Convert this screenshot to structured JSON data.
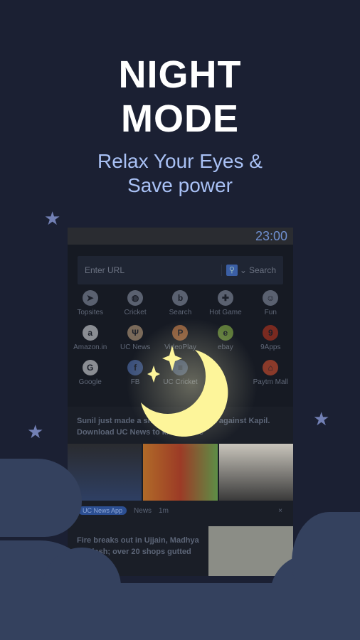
{
  "hero": {
    "title_line1": "NIGHT",
    "title_line2": "MODE",
    "subtitle_line1": "Relax Your Eyes &",
    "subtitle_line2": "Save power"
  },
  "phone": {
    "time": "23:00",
    "url_placeholder": "Enter URL",
    "search_label": "Search",
    "shortcuts": [
      {
        "label": "Topsites",
        "icon": "compass"
      },
      {
        "label": "Cricket",
        "icon": "cricket-ball"
      },
      {
        "label": "Search",
        "icon": "bing"
      },
      {
        "label": "Hot Game",
        "icon": "gamepad"
      },
      {
        "label": "Fun",
        "icon": "smiley"
      },
      {
        "label": "Amazon.in",
        "icon": "a"
      },
      {
        "label": "UC News",
        "icon": "deer"
      },
      {
        "label": "VideoPlay",
        "icon": "P"
      },
      {
        "label": "ebay",
        "icon": "ebay"
      },
      {
        "label": "9Apps",
        "icon": "9"
      },
      {
        "label": "Google",
        "icon": "G"
      },
      {
        "label": "FB",
        "icon": "f"
      },
      {
        "label": "UC Cricket",
        "icon": "stripes"
      },
      {
        "label": "",
        "icon": ""
      },
      {
        "label": "Paytm Mall",
        "icon": "bag"
      }
    ],
    "news1": {
      "title": "Sunil just made a shocking statement against Kapil. Download UC News to know more",
      "badge": "UC News App",
      "category": "News",
      "age": "1m",
      "close": "×"
    },
    "news2": {
      "title": "Fire breaks out in Ujjain, Madhya Pradesh; over 20 shops gutted"
    }
  },
  "colors": {
    "background": "#1b2033",
    "subtitle": "#a9c1f5",
    "moon": "#fdf59a",
    "cloud": "#34415e"
  }
}
